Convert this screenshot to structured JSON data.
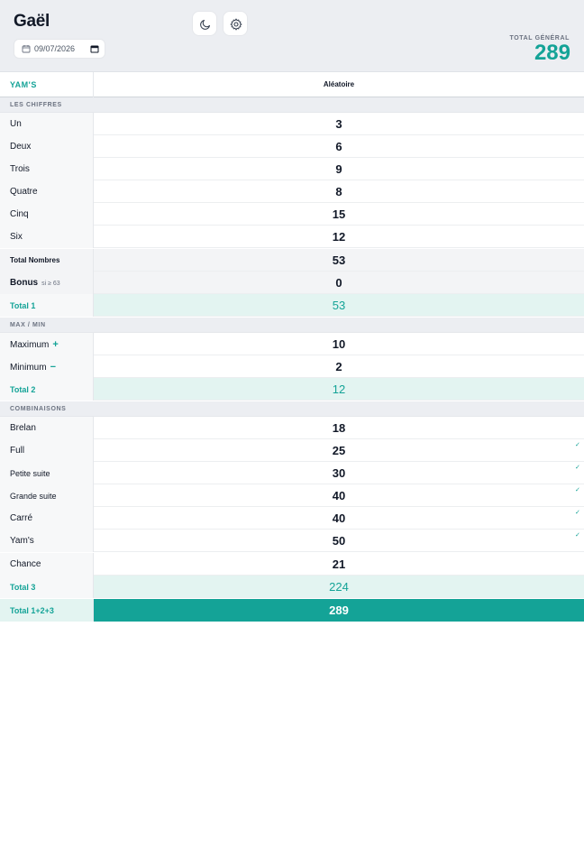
{
  "header": {
    "player_name": "Gaël",
    "date_value": "09/07/2026",
    "grand_total_label": "TOTAL GÉNÉRAL",
    "grand_total_value": "289"
  },
  "columns": {
    "game_label": "YAM'S",
    "mode_label": "Aléatoire"
  },
  "sections": {
    "chiffres": "LES CHIFFRES",
    "maxmin": "MAX / MIN",
    "combinaisons": "COMBINAISONS"
  },
  "chiffres": [
    {
      "label": "Un",
      "value": "3"
    },
    {
      "label": "Deux",
      "value": "6"
    },
    {
      "label": "Trois",
      "value": "9"
    },
    {
      "label": "Quatre",
      "value": "8"
    },
    {
      "label": "Cinq",
      "value": "15"
    },
    {
      "label": "Six",
      "value": "12"
    }
  ],
  "total_nombres": {
    "label": "Total Nombres",
    "value": "53"
  },
  "bonus": {
    "label": "Bonus",
    "hint": "si ≥ 63",
    "value": "0"
  },
  "total1": {
    "label": "Total 1",
    "value": "53"
  },
  "maxmin": {
    "maximum": {
      "label": "Maximum",
      "sign": "+",
      "value": "10"
    },
    "minimum": {
      "label": "Minimum",
      "sign": "−",
      "value": "2"
    }
  },
  "total2": {
    "label": "Total 2",
    "value": "12"
  },
  "combinaisons": [
    {
      "label": "Brelan",
      "value": "18",
      "check": ""
    },
    {
      "label": "Full",
      "value": "25",
      "check": "✓"
    },
    {
      "label": "Petite suite",
      "value": "30",
      "check": "✓"
    },
    {
      "label": "Grande suite",
      "value": "40",
      "check": "✓"
    },
    {
      "label": "Carré",
      "value": "40",
      "check": "✓"
    },
    {
      "label": "Yam's",
      "value": "50",
      "check": "✓"
    },
    {
      "label": "Chance",
      "value": "21",
      "check": ""
    }
  ],
  "total3": {
    "label": "Total 3",
    "value": "224"
  },
  "total_final": {
    "label": "Total 1+2+3",
    "value": "289"
  },
  "icons": {
    "calendar": "calendar-icon",
    "moon": "moon-icon",
    "gear": "gear-icon",
    "check": "check-icon"
  },
  "colors": {
    "accent": "#14a397",
    "total_bg": "#e3f4f1",
    "header_bg": "#eceef2"
  }
}
